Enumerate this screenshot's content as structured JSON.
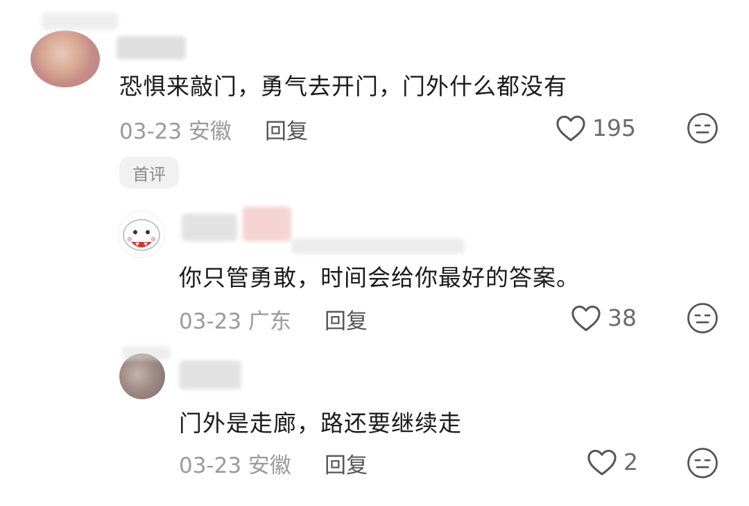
{
  "comments": [
    {
      "text": "恐惧来敲门，勇气去开门，门外什么都没有",
      "date_location": "03-23 安徽",
      "reply_label": "回复",
      "likes": "195",
      "badge": "首评",
      "author_name": ""
    },
    {
      "text": "你只管勇敢，时间会给你最好的答案。",
      "date_location": "03-23 广东",
      "reply_label": "回复",
      "likes": "38",
      "author_name": ""
    },
    {
      "text": "门外是走廊，路还要继续走",
      "date_location": "03-23 安徽",
      "reply_label": "回复",
      "likes": "2",
      "author_name": ""
    }
  ],
  "icons": {
    "like": "heart-outline-icon",
    "reaction": "neutral-face-icon"
  },
  "colors": {
    "text": "#1a1a1a",
    "meta": "#9a9a9a",
    "icon": "#555555",
    "badge_bg": "#f1f1f1"
  }
}
